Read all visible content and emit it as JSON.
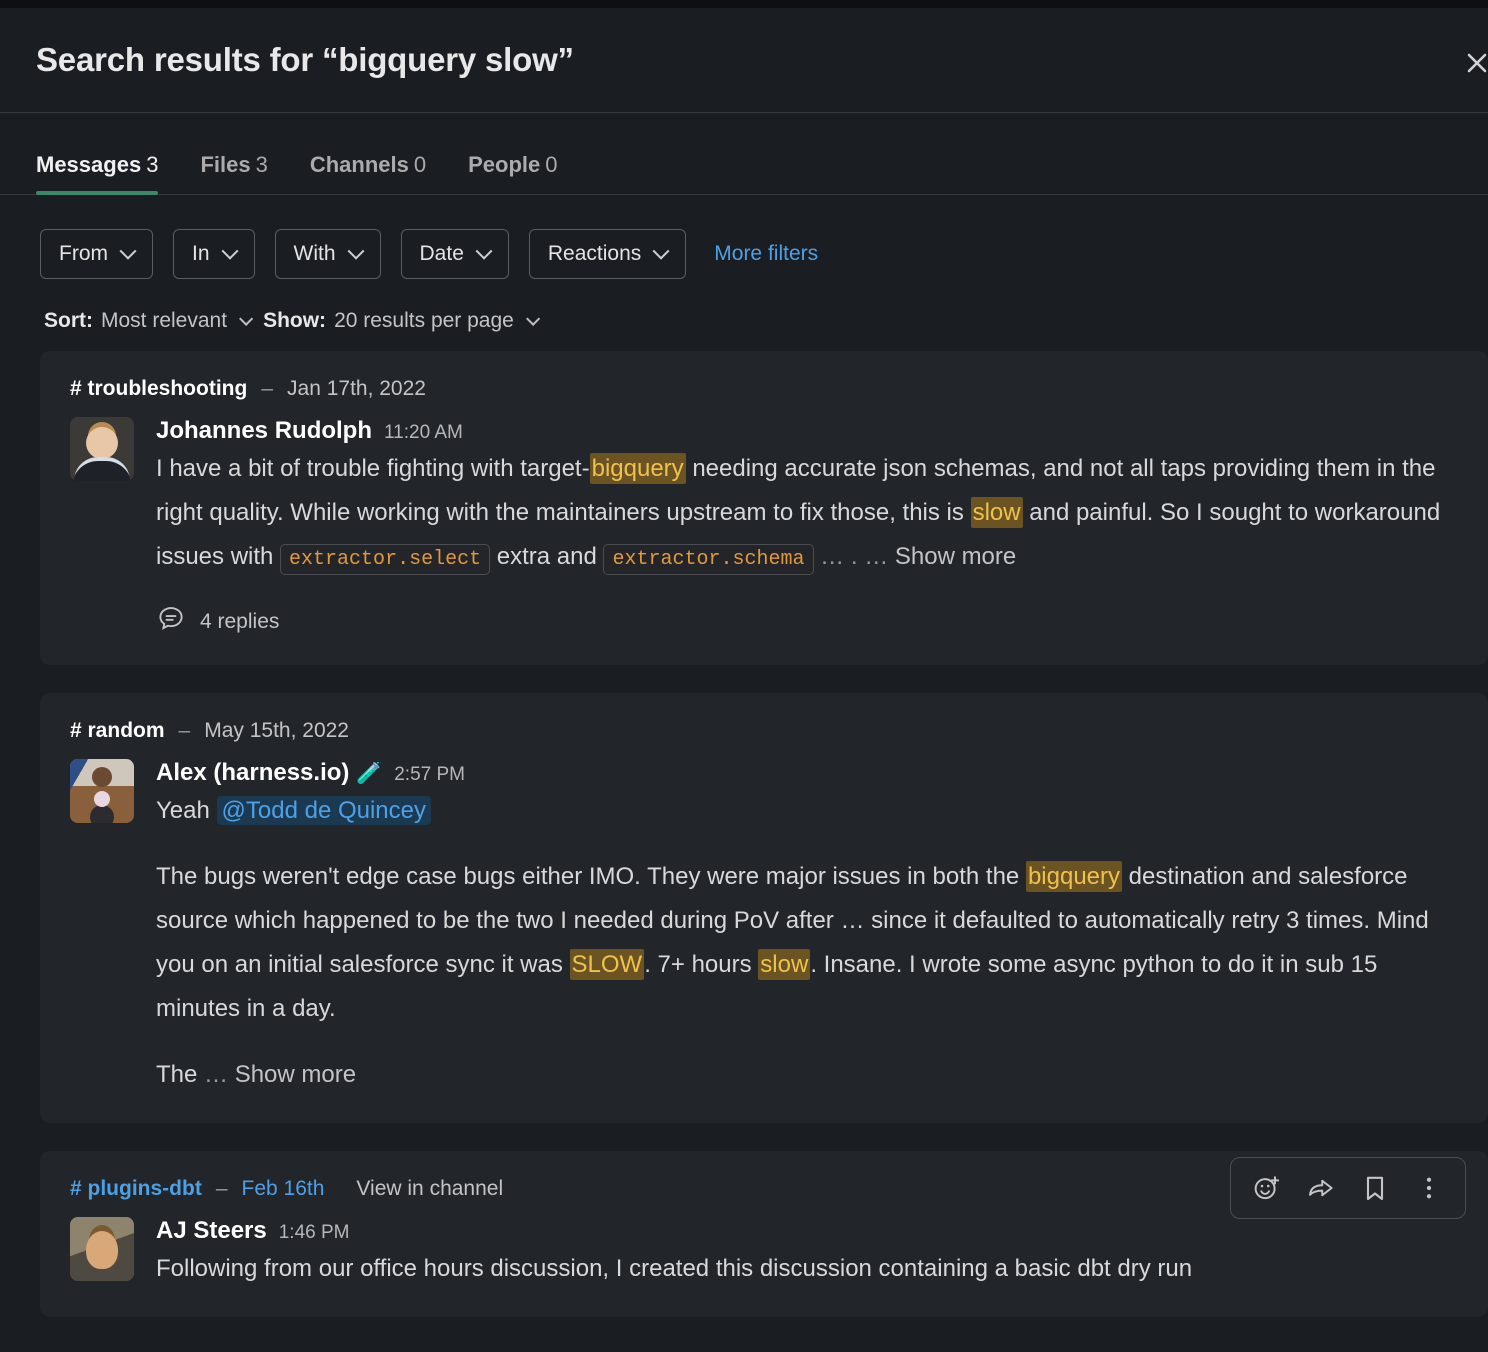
{
  "header": {
    "title": "Search results for “bigquery slow”",
    "close_icon": "close-icon"
  },
  "tabs": [
    {
      "label": "Messages",
      "count": "3",
      "active": true
    },
    {
      "label": "Files",
      "count": "3",
      "active": false
    },
    {
      "label": "Channels",
      "count": "0",
      "active": false
    },
    {
      "label": "People",
      "count": "0",
      "active": false
    }
  ],
  "filters": {
    "pills": [
      {
        "label": "From"
      },
      {
        "label": "In"
      },
      {
        "label": "With"
      },
      {
        "label": "Date"
      },
      {
        "label": "Reactions"
      }
    ],
    "more_filters": "More filters"
  },
  "sort": {
    "sort_label": "Sort:",
    "sort_value": "Most relevant",
    "show_label": "Show:",
    "show_value": "20 results per page"
  },
  "results": [
    {
      "channel": "# troubleshooting",
      "dash": "–",
      "date": "Jan 17th, 2022",
      "author": "Johannes Rudolph",
      "time": "11:20 AM",
      "text_parts": {
        "p1": "I have a bit of trouble fighting with target-",
        "hl1": "bigquery",
        "p2": " needing accurate json schemas, and not all taps providing them in the right quality. While working with the maintainers upstream to fix those, this is ",
        "hl2": "slow",
        "p3": " and painful. So I sought to workaround issues with ",
        "code1": "extractor.select",
        "p4": " extra and ",
        "code2": "extractor.schema",
        "p5": " …  .  … ",
        "show_more": "Show more"
      },
      "replies": "4 replies"
    },
    {
      "channel": "# random",
      "dash": "–",
      "date": "May 15th, 2022",
      "author": "Alex (harness.io)",
      "author_emoji": "🧪",
      "time": "2:57 PM",
      "line1_prefix": "Yeah ",
      "mention": "@Todd de Quincey",
      "text_parts": {
        "p1": "The bugs weren't edge case bugs either IMO. They were major issues in both the ",
        "hl1": "bigquery",
        "p2": " destination and salesforce source which happened to be the two I needed during PoV after … since it defaulted to automatically retry 3 times. Mind you on an initial salesforce sync it was ",
        "hl2": "SLOW",
        "p3": ". 7+ hours ",
        "hl3": "slow",
        "p4": ". Insane. I wrote some async python to do it in sub 15 minutes in a day."
      },
      "tail_text": "The ",
      "tail_ellipsis": "… ",
      "tail_show_more": "Show more"
    },
    {
      "channel": "# plugins-dbt",
      "dash": "–",
      "date": "Feb 16th",
      "view_in_channel": "View in channel",
      "author": "AJ Steers",
      "time": "1:46 PM",
      "text": "Following from our office hours discussion, I created this discussion containing a basic dbt dry run",
      "actions": [
        {
          "icon": "add-reaction-icon"
        },
        {
          "icon": "share-message-icon"
        },
        {
          "icon": "save-message-icon"
        },
        {
          "icon": "more-actions-icon"
        }
      ]
    }
  ],
  "colors": {
    "page_bg": "#1a1d21",
    "card_bg": "#222529",
    "accent_tab": "#3a8968",
    "link": "#4ea0e6",
    "highlight_bg": "#6b5422",
    "highlight_text": "#efc14e",
    "code_text": "#e0993e"
  }
}
